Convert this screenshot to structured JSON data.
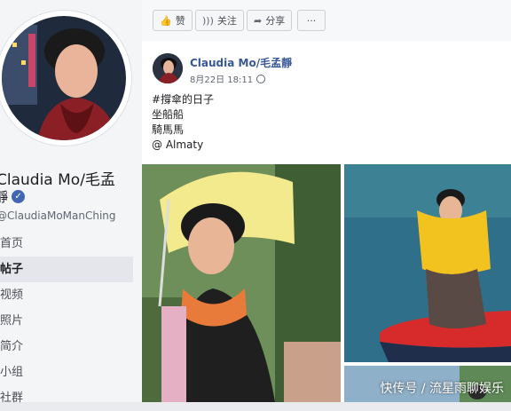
{
  "profile": {
    "name": "Claudia Mo/毛孟",
    "name_line2": "靜",
    "handle": "@ClaudiaMoManChing"
  },
  "nav": [
    {
      "label": "首页",
      "active": false
    },
    {
      "label": "帖子",
      "active": true
    },
    {
      "label": "视频",
      "active": false
    },
    {
      "label": "照片",
      "active": false
    },
    {
      "label": "简介",
      "active": false
    },
    {
      "label": "小组",
      "active": false
    },
    {
      "label": "社群",
      "active": false
    }
  ],
  "actions": {
    "like": "赞",
    "follow": "关注",
    "share": "分享",
    "more": "···"
  },
  "post": {
    "author": "Claudia Mo/毛孟靜",
    "date": "8月22日 18:11",
    "lines": [
      "#撐傘的日子",
      "坐船船",
      "騎馬馬",
      "@ Almaty"
    ]
  },
  "watermark": "快传号 / 流星雨聊娱乐",
  "colors": {
    "link": "#385898",
    "verified": "#4267b2",
    "raft": "#d72b2b"
  }
}
